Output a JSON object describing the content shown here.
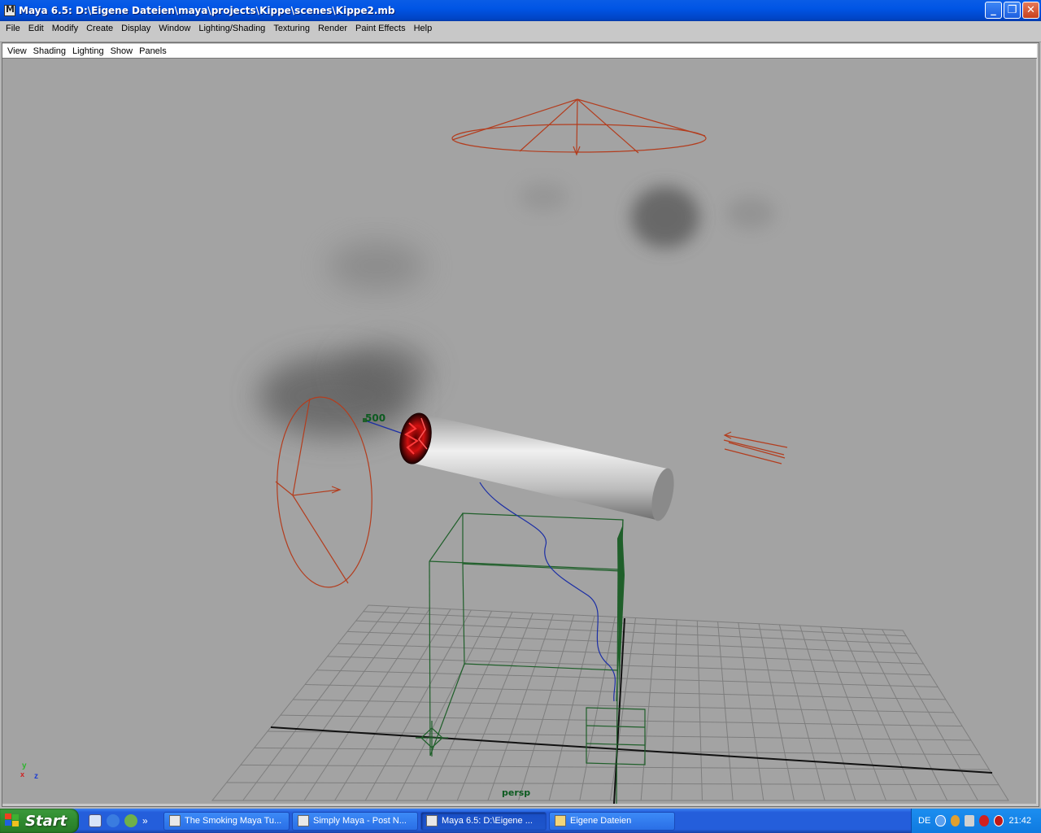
{
  "window": {
    "title": "Maya 6.5: D:\\Eigene Dateien\\maya\\projects\\Kippe\\scenes\\Kippe2.mb"
  },
  "main_menu": [
    "File",
    "Edit",
    "Modify",
    "Create",
    "Display",
    "Window",
    "Lighting/Shading",
    "Texturing",
    "Render",
    "Paint Effects",
    "Help"
  ],
  "panel_menu": [
    "View",
    "Shading",
    "Lighting",
    "Show",
    "Panels"
  ],
  "viewport": {
    "camera_label": "persp",
    "value_label": "500",
    "axis": {
      "x": "x",
      "y": "y",
      "z": "z"
    }
  },
  "taskbar": {
    "start_label": "Start",
    "quick_launch_more": "»",
    "tasks": [
      {
        "label": "The Smoking Maya Tu...",
        "active": false
      },
      {
        "label": "Simply Maya - Post N...",
        "active": false
      },
      {
        "label": "Maya 6.5: D:\\Eigene ...",
        "active": true
      },
      {
        "label": "Eigene Dateien",
        "active": false
      }
    ],
    "tray": {
      "language": "DE",
      "time": "21:42"
    }
  },
  "colors": {
    "titlebar": "#0055e5",
    "viewport_bg": "#a3a3a3",
    "light_wire": "#b33d1e",
    "field_wire": "#1f5f2a",
    "curve": "#1b2ea5"
  }
}
